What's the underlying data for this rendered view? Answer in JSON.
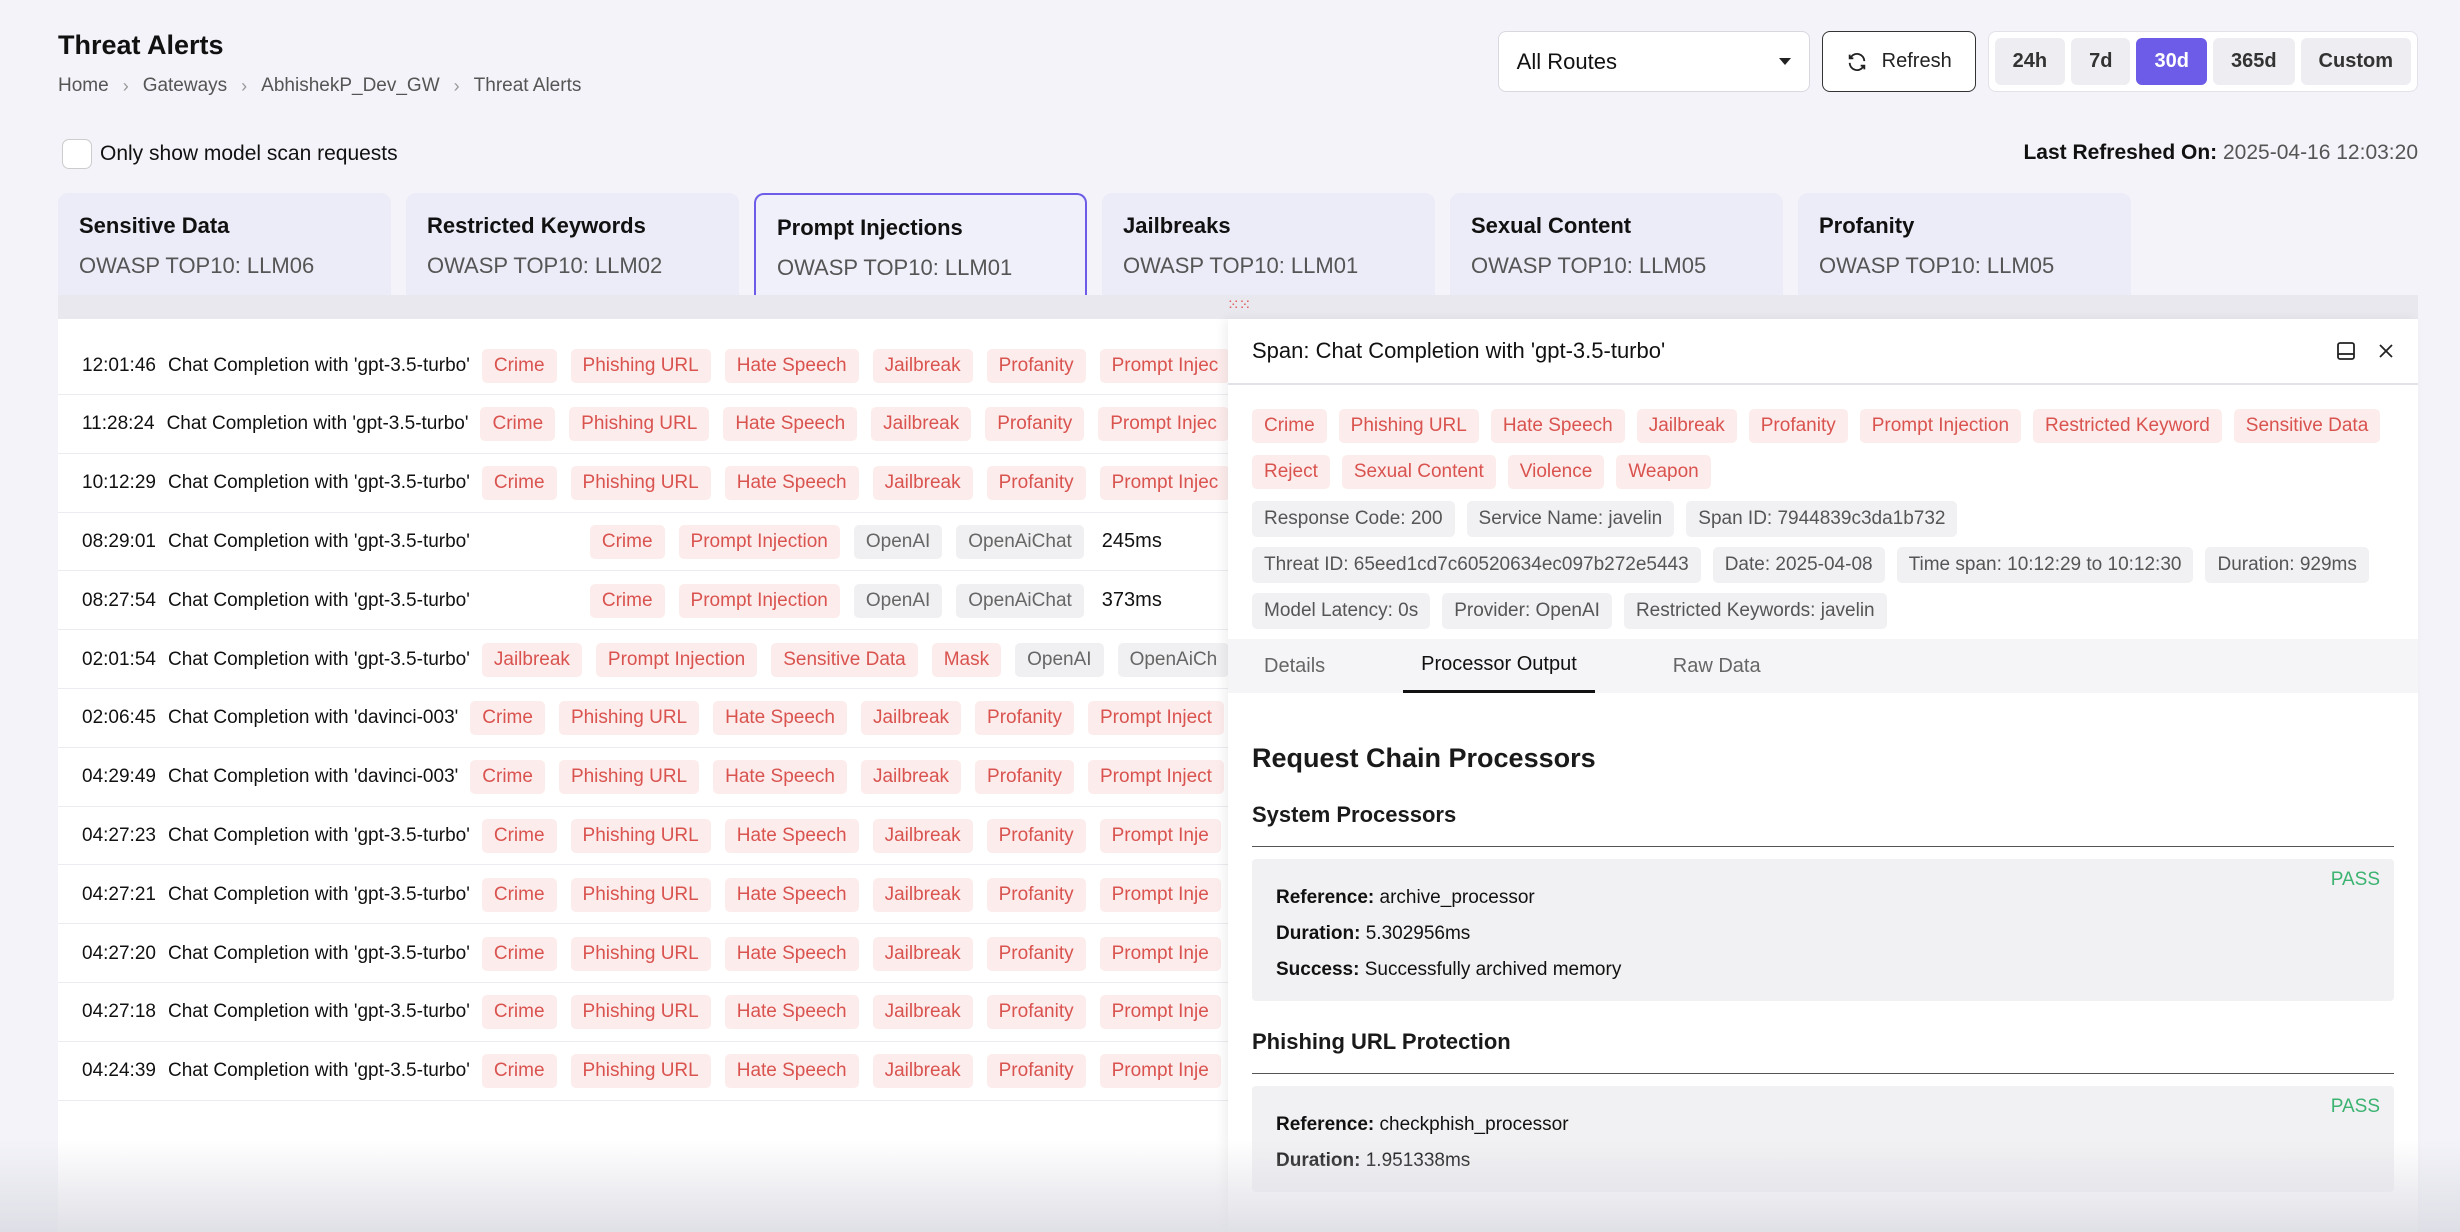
{
  "page": {
    "title": "Threat Alerts",
    "breadcrumb": [
      "Home",
      "Gateways",
      "AbhishekP_Dev_GW",
      "Threat Alerts"
    ]
  },
  "controls": {
    "route_value": "All Routes",
    "refresh_label": "Refresh",
    "ranges": [
      "24h",
      "7d",
      "30d",
      "365d",
      "Custom"
    ],
    "active_range": "30d"
  },
  "filter": {
    "checkbox_label": "Only show model scan requests",
    "last_refreshed_label": "Last Refreshed On:",
    "last_refreshed_value": "2025-04-16 12:03:20"
  },
  "categories": [
    {
      "title": "Sensitive Data",
      "sub": "OWASP TOP10: LLM06"
    },
    {
      "title": "Restricted Keywords",
      "sub": "OWASP TOP10: LLM02"
    },
    {
      "title": "Prompt Injections",
      "sub": "OWASP TOP10: LLM01"
    },
    {
      "title": "Jailbreaks",
      "sub": "OWASP TOP10: LLM01"
    },
    {
      "title": "Sexual Content",
      "sub": "OWASP TOP10: LLM05"
    },
    {
      "title": "Profanity",
      "sub": "OWASP TOP10: LLM05"
    }
  ],
  "rows": [
    {
      "time": "12:01:46",
      "name": "Chat Completion with 'gpt-3.5-turbo'",
      "tags": [
        [
          "Crime",
          "red"
        ],
        [
          "Phishing URL",
          "red"
        ],
        [
          "Hate Speech",
          "red"
        ],
        [
          "Jailbreak",
          "red"
        ],
        [
          "Profanity",
          "red"
        ],
        [
          "Prompt Injec",
          "red"
        ]
      ]
    },
    {
      "time": "11:28:24",
      "name": "Chat Completion with 'gpt-3.5-turbo'",
      "tags": [
        [
          "Crime",
          "red"
        ],
        [
          "Phishing URL",
          "red"
        ],
        [
          "Hate Speech",
          "red"
        ],
        [
          "Jailbreak",
          "red"
        ],
        [
          "Profanity",
          "red"
        ],
        [
          "Prompt Injec",
          "red"
        ]
      ]
    },
    {
      "time": "10:12:29",
      "name": "Chat Completion with 'gpt-3.5-turbo'",
      "tags": [
        [
          "Crime",
          "red"
        ],
        [
          "Phishing URL",
          "red"
        ],
        [
          "Hate Speech",
          "red"
        ],
        [
          "Jailbreak",
          "red"
        ],
        [
          "Profanity",
          "red"
        ],
        [
          "Prompt Injec",
          "red"
        ]
      ]
    },
    {
      "time": "08:29:01",
      "name": "Chat Completion with 'gpt-3.5-turbo'",
      "indent": 120,
      "tags": [
        [
          "Crime",
          "red"
        ],
        [
          "Prompt Injection",
          "red"
        ],
        [
          "OpenAI",
          "gray"
        ],
        [
          "OpenAiChat",
          "gray"
        ],
        [
          "245ms",
          "blank"
        ]
      ]
    },
    {
      "time": "08:27:54",
      "name": "Chat Completion with 'gpt-3.5-turbo'",
      "indent": 120,
      "tags": [
        [
          "Crime",
          "red"
        ],
        [
          "Prompt Injection",
          "red"
        ],
        [
          "OpenAI",
          "gray"
        ],
        [
          "OpenAiChat",
          "gray"
        ],
        [
          "373ms",
          "blank"
        ]
      ]
    },
    {
      "time": "02:01:54",
      "name": "Chat Completion with 'gpt-3.5-turbo'",
      "tags": [
        [
          "Jailbreak",
          "red"
        ],
        [
          "Prompt Injection",
          "red"
        ],
        [
          "Sensitive Data",
          "red"
        ],
        [
          "Mask",
          "red"
        ],
        [
          "OpenAI",
          "gray"
        ],
        [
          "OpenAiCh",
          "gray"
        ]
      ]
    },
    {
      "time": "02:06:45",
      "name": "Chat Completion with 'davinci-003'",
      "tags": [
        [
          "Crime",
          "red"
        ],
        [
          "Phishing URL",
          "red"
        ],
        [
          "Hate Speech",
          "red"
        ],
        [
          "Jailbreak",
          "red"
        ],
        [
          "Profanity",
          "red"
        ],
        [
          "Prompt Inject",
          "red"
        ]
      ]
    },
    {
      "time": "04:29:49",
      "name": "Chat Completion with 'davinci-003'",
      "tags": [
        [
          "Crime",
          "red"
        ],
        [
          "Phishing URL",
          "red"
        ],
        [
          "Hate Speech",
          "red"
        ],
        [
          "Jailbreak",
          "red"
        ],
        [
          "Profanity",
          "red"
        ],
        [
          "Prompt Inject",
          "red"
        ]
      ]
    },
    {
      "time": "04:27:23",
      "name": "Chat Completion with 'gpt-3.5-turbo'",
      "tags": [
        [
          "Crime",
          "red"
        ],
        [
          "Phishing URL",
          "red"
        ],
        [
          "Hate Speech",
          "red"
        ],
        [
          "Jailbreak",
          "red"
        ],
        [
          "Profanity",
          "red"
        ],
        [
          "Prompt Inje",
          "red"
        ]
      ]
    },
    {
      "time": "04:27:21",
      "name": "Chat Completion with 'gpt-3.5-turbo'",
      "tags": [
        [
          "Crime",
          "red"
        ],
        [
          "Phishing URL",
          "red"
        ],
        [
          "Hate Speech",
          "red"
        ],
        [
          "Jailbreak",
          "red"
        ],
        [
          "Profanity",
          "red"
        ],
        [
          "Prompt Inje",
          "red"
        ]
      ]
    },
    {
      "time": "04:27:20",
      "name": "Chat Completion with 'gpt-3.5-turbo'",
      "tags": [
        [
          "Crime",
          "red"
        ],
        [
          "Phishing URL",
          "red"
        ],
        [
          "Hate Speech",
          "red"
        ],
        [
          "Jailbreak",
          "red"
        ],
        [
          "Profanity",
          "red"
        ],
        [
          "Prompt Inje",
          "red"
        ]
      ]
    },
    {
      "time": "04:27:18",
      "name": "Chat Completion with 'gpt-3.5-turbo'",
      "tags": [
        [
          "Crime",
          "red"
        ],
        [
          "Phishing URL",
          "red"
        ],
        [
          "Hate Speech",
          "red"
        ],
        [
          "Jailbreak",
          "red"
        ],
        [
          "Profanity",
          "red"
        ],
        [
          "Prompt Inje",
          "red"
        ]
      ]
    },
    {
      "time": "04:24:39",
      "name": "Chat Completion with 'gpt-3.5-turbo'",
      "tags": [
        [
          "Crime",
          "red"
        ],
        [
          "Phishing URL",
          "red"
        ],
        [
          "Hate Speech",
          "red"
        ],
        [
          "Jailbreak",
          "red"
        ],
        [
          "Profanity",
          "red"
        ],
        [
          "Prompt Inje",
          "red"
        ]
      ]
    }
  ],
  "panel": {
    "title": "Span: Chat Completion with 'gpt-3.5-turbo'",
    "tags": [
      "Crime",
      "Phishing URL",
      "Hate Speech",
      "Jailbreak",
      "Profanity",
      "Prompt Injection",
      "Restricted Keyword",
      "Sensitive Data",
      "Reject",
      "Sexual Content",
      "Violence",
      "Weapon"
    ],
    "meta": [
      "Response Code: 200",
      "Service Name: javelin",
      "Span ID: 7944839c3da1b732",
      "Threat ID: 65eed1cd7c60520634ec097b272e5443",
      "Date: 2025-04-08",
      "Time span: 10:12:29 to 10:12:30",
      "Duration: 929ms",
      "Model Latency: 0s",
      "Provider: OpenAI",
      "Restricted Keywords: javelin"
    ],
    "tabs": [
      "Details",
      "Processor Output",
      "Raw Data"
    ],
    "active_tab": "Processor Output",
    "chain_title": "Request Chain Processors",
    "sections": [
      {
        "heading": "System Processors",
        "status": "PASS",
        "lines": [
          {
            "k": "Reference:",
            "v": "archive_processor"
          },
          {
            "k": "Duration:",
            "v": "5.302956ms"
          },
          {
            "k": "Success:",
            "v": "Successfully archived memory"
          }
        ]
      },
      {
        "heading": "Phishing URL Protection",
        "status": "PASS",
        "lines": [
          {
            "k": "Reference:",
            "v": "checkphish_processor"
          },
          {
            "k": "Duration:",
            "v": "1.951338ms"
          }
        ]
      }
    ]
  },
  "colors": {
    "accent": "#6c5ce7",
    "tag_red_bg": "#fdecec",
    "tag_red_text": "#d9534f",
    "pass": "#3cb371"
  }
}
